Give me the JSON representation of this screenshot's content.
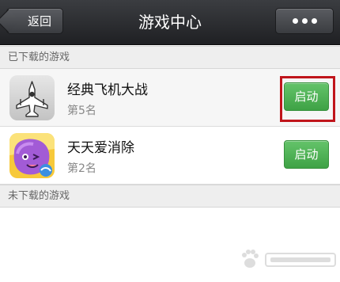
{
  "navbar": {
    "back_label": "返回",
    "title": "游戏中心"
  },
  "sections": [
    {
      "label": "已下载的游戏"
    },
    {
      "label": "未下载的游戏"
    }
  ],
  "games": [
    {
      "name": "经典飞机大战",
      "rank": "第5名",
      "action": "启动",
      "icon": "airplane-icon"
    },
    {
      "name": "天天爱消除",
      "rank": "第2名",
      "action": "启动",
      "icon": "purple-creature-icon"
    }
  ],
  "colors": {
    "navbar": "#2b2d31",
    "launch_button": "#4cae52",
    "highlight": "#c0151b"
  }
}
